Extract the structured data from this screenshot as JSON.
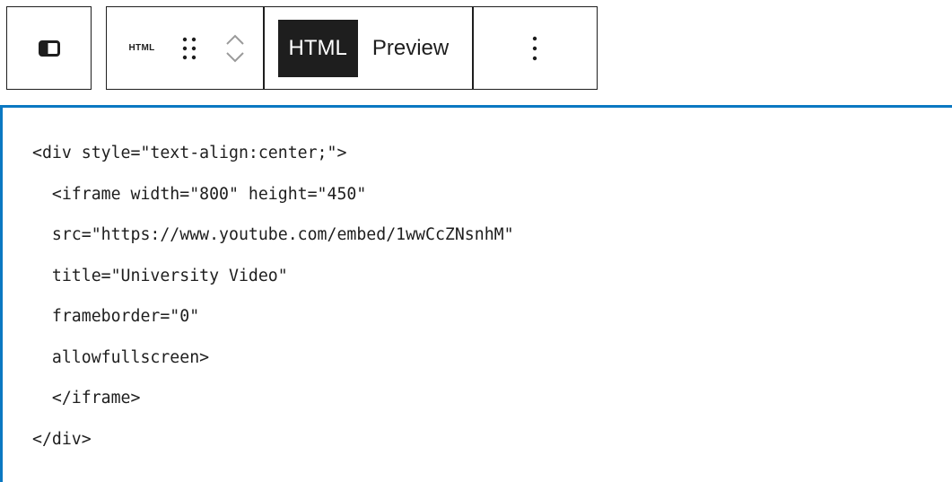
{
  "toolbar": {
    "sidebar_toggle_icon": "sidebar-toggle-icon",
    "block_type_label": "HTML",
    "drag_icon": "drag-handle-icon",
    "move_up_icon": "chevron-up-icon",
    "move_down_icon": "chevron-down-icon",
    "mode_html_label": "HTML",
    "mode_preview_label": "Preview",
    "more_icon": "vertical-ellipsis-icon"
  },
  "editor": {
    "lines": [
      "<div style=\"text-align:center;\">",
      "  <iframe width=\"800\" height=\"450\"",
      "  src=\"https://www.youtube.com/embed/1wwCcZNsnhM\"",
      "  title=\"University Video\"",
      "  frameborder=\"0\"",
      "  allowfullscreen>",
      "  </iframe>",
      "</div>"
    ]
  },
  "colors": {
    "focus_border": "#0b78c2",
    "toolbar_border": "#1e1e1e",
    "active_mode_bg": "#1e1e1e"
  }
}
